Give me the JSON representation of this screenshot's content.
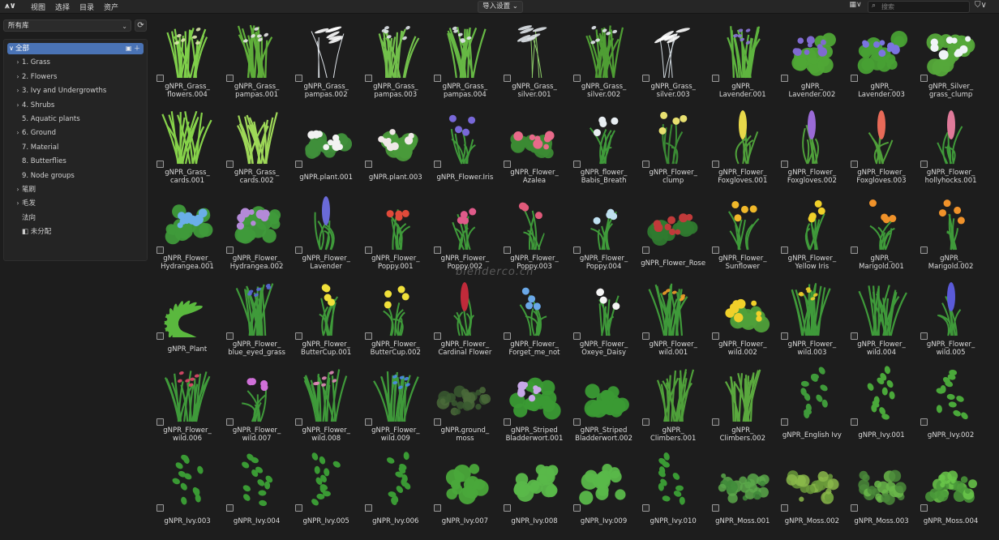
{
  "topbar": {
    "logo": "⩚∨",
    "menu": [
      "视图",
      "选择",
      "目录",
      "资产"
    ],
    "import_label": "导入设置 ⌄",
    "grid_toggle": "▦∨",
    "search_placeholder": "搜索",
    "filter": "⛉∨"
  },
  "sidebar": {
    "library": "所有库",
    "items": [
      {
        "label": "全部",
        "chev": "∨",
        "selected": true,
        "indent": 0
      },
      {
        "label": "1. Grass",
        "chev": "›",
        "indent": 1
      },
      {
        "label": "2. Flowers",
        "chev": "›",
        "indent": 1
      },
      {
        "label": "3. Ivy and Undergrowths",
        "chev": "›",
        "indent": 1
      },
      {
        "label": "4. Shrubs",
        "chev": "›",
        "indent": 1
      },
      {
        "label": "5. Aquatic plants",
        "chev": "",
        "indent": 1
      },
      {
        "label": "6. Ground",
        "chev": "›",
        "indent": 1
      },
      {
        "label": "7. Material",
        "chev": "",
        "indent": 1
      },
      {
        "label": "8. Butterflies",
        "chev": "",
        "indent": 1
      },
      {
        "label": "9. Node groups",
        "chev": "",
        "indent": 1
      },
      {
        "label": "笔刷",
        "chev": "›",
        "indent": 1
      },
      {
        "label": "毛发",
        "chev": "›",
        "indent": 1
      },
      {
        "label": "法向",
        "chev": "",
        "indent": 1
      },
      {
        "label": "未分配",
        "chev": "",
        "indent": 1,
        "icon": "file-icon"
      }
    ]
  },
  "watermark": "blenderco.cn",
  "assets": [
    {
      "label": "gNPR_Grass_\nflowers.004",
      "kind": "grass",
      "color": "#7fcf4a",
      "accent": "#dfe8b0"
    },
    {
      "label": "gNPR_Grass_\npampas.001",
      "kind": "pampas",
      "color": "#5fae3a",
      "accent": "#e8e8e8"
    },
    {
      "label": "gNPR_Grass_\npampas.002",
      "kind": "wisp",
      "color": "#dfe4ea",
      "accent": "#ffffff"
    },
    {
      "label": "gNPR_Grass_\npampas.003",
      "kind": "pampas",
      "color": "#72c04b",
      "accent": "#e0e6ea"
    },
    {
      "label": "gNPR_Grass_\npampas.004",
      "kind": "pampas",
      "color": "#66b844",
      "accent": "#e0e6ea"
    },
    {
      "label": "gNPR_Grass_\nsilver.001",
      "kind": "wisp",
      "color": "#8fd06a",
      "accent": "#e0e6ea"
    },
    {
      "label": "gNPR_Grass_\nsilver.002",
      "kind": "grass",
      "color": "#4f9e34",
      "accent": "#e5eaf0"
    },
    {
      "label": "gNPR_Grass_\nsilver.003",
      "kind": "wisp",
      "color": "#d0d8de",
      "accent": "#ffffff"
    },
    {
      "label": "gNPR_\nLavender.001",
      "kind": "grass",
      "color": "#5eb43f",
      "accent": "#8a74d6"
    },
    {
      "label": "gNPR_\nLavender.002",
      "kind": "bush",
      "color": "#4fa636",
      "accent": "#7f6ad0"
    },
    {
      "label": "gNPR_\nLavender.003",
      "kind": "bush",
      "color": "#48a034",
      "accent": "#7a74e0"
    },
    {
      "label": "gNPR_Silver_\ngrass_clump",
      "kind": "bush",
      "color": "#55a83a",
      "accent": "#f0f4f8"
    },
    {
      "label": "gNPR_Grass_\ncards.001",
      "kind": "grass",
      "color": "#86d24a",
      "accent": "#86d24a"
    },
    {
      "label": "gNPR_Grass_\ncards.002",
      "kind": "grass",
      "color": "#9ed858",
      "accent": "#9ed858"
    },
    {
      "label": "gNPR.plant.001",
      "kind": "low",
      "color": "#3f8f3a",
      "accent": "#f2f2f2"
    },
    {
      "label": "gNPR.plant.003",
      "kind": "low",
      "color": "#4a9a3a",
      "accent": "#f0e8e8"
    },
    {
      "label": "gNPR_Flower.Iris",
      "kind": "flower",
      "color": "#3f9a3a",
      "accent": "#7868d8"
    },
    {
      "label": "gNPR_Flower_\nAzalea",
      "kind": "low",
      "color": "#3b8a34",
      "accent": "#e86a8a"
    },
    {
      "label": "gNPR_flower_\nBabis_Breath",
      "kind": "flower",
      "color": "#3f9a3a",
      "accent": "#e8eef2"
    },
    {
      "label": "gNPR_Flower_\nclump",
      "kind": "flower",
      "color": "#3a8a34",
      "accent": "#e8e070"
    },
    {
      "label": "gNPR_Flower_\nFoxgloves.001",
      "kind": "spike",
      "color": "#4fa03a",
      "accent": "#e8d84a"
    },
    {
      "label": "gNPR_Flower_\nFoxgloves.002",
      "kind": "spike",
      "color": "#4fa03a",
      "accent": "#9a6ad6"
    },
    {
      "label": "gNPR_Flower_\nFoxgloves.003",
      "kind": "spike",
      "color": "#4fa03a",
      "accent": "#e86a58"
    },
    {
      "label": "gNPR_Flower_\nhollyhocks.001",
      "kind": "spike",
      "color": "#3f9a3a",
      "accent": "#e07a9a"
    },
    {
      "label": "gNPR_Flower_\nHydrangea.001",
      "kind": "bush",
      "color": "#3f9a3a",
      "accent": "#6aaee8"
    },
    {
      "label": "gNPR_Flower_\nHydrangea.002",
      "kind": "bush",
      "color": "#3f9a3a",
      "accent": "#b48ad8"
    },
    {
      "label": "gNPR_Flower_\nLavender",
      "kind": "spike",
      "color": "#3f9a3a",
      "accent": "#6a6ad8"
    },
    {
      "label": "gNPR_Flower_\nPoppy.001",
      "kind": "flower",
      "color": "#3f9a3a",
      "accent": "#e04a3a"
    },
    {
      "label": "gNPR_Flower_\nPoppy.002",
      "kind": "flower",
      "color": "#3f9a3a",
      "accent": "#e05a8a"
    },
    {
      "label": "gNPR_Flower_\nPoppy.003",
      "kind": "flower",
      "color": "#3f9a3a",
      "accent": "#e05a7a"
    },
    {
      "label": "gNPR_Flower_\nPoppy.004",
      "kind": "flower",
      "color": "#3f9a3a",
      "accent": "#bfe0f0"
    },
    {
      "label": "gNPR_Flower_Rose",
      "kind": "low",
      "color": "#2f7a2f",
      "accent": "#c03a3a"
    },
    {
      "label": "gNPR_Flower_\nSunflower",
      "kind": "flower",
      "color": "#3f9a3a",
      "accent": "#f0b82a"
    },
    {
      "label": "gNPR_Flower_\nYellow Iris",
      "kind": "flower",
      "color": "#3f9a3a",
      "accent": "#f0d02a"
    },
    {
      "label": "gNPR_\nMarigold.001",
      "kind": "flower",
      "color": "#3f9a3a",
      "accent": "#f0922a"
    },
    {
      "label": "gNPR_\nMarigold.002",
      "kind": "flower",
      "color": "#3f9a3a",
      "accent": "#f0922a"
    },
    {
      "label": "gNPR_Plant",
      "kind": "leafy",
      "color": "#5ab83e",
      "accent": "#5ab83e"
    },
    {
      "label": "gNPR_Flower_\nblue_eyed_grass",
      "kind": "grass",
      "color": "#3f9a3a",
      "accent": "#5a6ad8"
    },
    {
      "label": "gNPR_Flower_\nButterCup.001",
      "kind": "flower",
      "color": "#3f9a3a",
      "accent": "#f0e03a"
    },
    {
      "label": "gNPR_Flower_\nButterCup.002",
      "kind": "flower",
      "color": "#3f9a3a",
      "accent": "#f0e03a"
    },
    {
      "label": "gNPR_Flower_\nCardinal Flower",
      "kind": "spike",
      "color": "#3f9a3a",
      "accent": "#c02a3a"
    },
    {
      "label": "gNPR_Flower_\nForget_me_not",
      "kind": "flower",
      "color": "#3f9a3a",
      "accent": "#6aa8e8"
    },
    {
      "label": "gNPR_Flower_\nOxeye_Daisy",
      "kind": "flower",
      "color": "#3f9a3a",
      "accent": "#f4f4f4"
    },
    {
      "label": "gNPR_Flower_\nwild.001",
      "kind": "grass",
      "color": "#3f9a3a",
      "accent": "#f0a02a"
    },
    {
      "label": "gNPR_Flower_\nwild.002",
      "kind": "low",
      "color": "#4fa03a",
      "accent": "#f0d02a"
    },
    {
      "label": "gNPR_Flower_\nwild.003",
      "kind": "grass",
      "color": "#3f9a3a",
      "accent": "#f0d02a"
    },
    {
      "label": "gNPR_Flower_\nwild.004",
      "kind": "grass",
      "color": "#3f9a3a",
      "accent": "#3f9a3a"
    },
    {
      "label": "gNPR_Flower_\nwild.005",
      "kind": "spike",
      "color": "#3f9a3a",
      "accent": "#5a5ad8"
    },
    {
      "label": "gNPR_Flower_\nwild.006",
      "kind": "grass",
      "color": "#3f9a3a",
      "accent": "#e04a6a"
    },
    {
      "label": "gNPR_Flower_\nwild.007",
      "kind": "flower",
      "color": "#3f9a3a",
      "accent": "#d070d8"
    },
    {
      "label": "gNPR_Flower_\nwild.008",
      "kind": "grass",
      "color": "#3f9a3a",
      "accent": "#e08ab8"
    },
    {
      "label": "gNPR_Flower_\nwild.009",
      "kind": "grass",
      "color": "#3f9a3a",
      "accent": "#4a8ae8"
    },
    {
      "label": "gNPR.ground_\nmoss",
      "kind": "moss",
      "color": "#3a5a30",
      "accent": "#4a6a3a"
    },
    {
      "label": "gNPR_Striped\nBladderwort.001",
      "kind": "bush",
      "color": "#3a9a34",
      "accent": "#c8a8e8"
    },
    {
      "label": "gNPR_Striped\nBladderwort.002",
      "kind": "bush",
      "color": "#3a9a34",
      "accent": "#3a9a34"
    },
    {
      "label": "gNPR_\nClimbers.001",
      "kind": "grass",
      "color": "#4fa03a",
      "accent": "#4fa03a"
    },
    {
      "label": "gNPR_\nClimbers.002",
      "kind": "grass",
      "color": "#5aa83e",
      "accent": "#5aa83e"
    },
    {
      "label": "gNPR_English Ivy",
      "kind": "ivy",
      "color": "#3f9a3a",
      "accent": "#3f9a3a"
    },
    {
      "label": "gNPR_Ivy.001",
      "kind": "ivy",
      "color": "#4aa83a",
      "accent": "#4aa83a"
    },
    {
      "label": "gNPR_Ivy.002",
      "kind": "ivy",
      "color": "#4aa83a",
      "accent": "#4aa83a"
    },
    {
      "label": "gNPR_Ivy.003",
      "kind": "ivy",
      "color": "#3a9a34",
      "accent": "#3a9a34"
    },
    {
      "label": "gNPR_Ivy.004",
      "kind": "ivy",
      "color": "#3a9a34",
      "accent": "#3a9a34"
    },
    {
      "label": "gNPR_Ivy.005",
      "kind": "ivy",
      "color": "#3a9a34",
      "accent": "#3a9a34"
    },
    {
      "label": "gNPR_Ivy.006",
      "kind": "ivy",
      "color": "#3a9a34",
      "accent": "#3a9a34"
    },
    {
      "label": "gNPR_Ivy.007",
      "kind": "bush",
      "color": "#4aa83a",
      "accent": "#4aa83a"
    },
    {
      "label": "gNPR_Ivy.008",
      "kind": "bush",
      "color": "#5ab84a",
      "accent": "#5ab84a"
    },
    {
      "label": "gNPR_Ivy.009",
      "kind": "bush",
      "color": "#5ab84a",
      "accent": "#5ab84a"
    },
    {
      "label": "gNPR_Ivy.010",
      "kind": "ivy",
      "color": "#3a9a34",
      "accent": "#3a9a34"
    },
    {
      "label": "gNPR_Moss.001",
      "kind": "moss",
      "color": "#3f8a3a",
      "accent": "#5aa84a"
    },
    {
      "label": "gNPR_Moss.002",
      "kind": "moss",
      "color": "#6a9a3a",
      "accent": "#8ab84a"
    },
    {
      "label": "gNPR_Moss.003",
      "kind": "moss",
      "color": "#4a8a3a",
      "accent": "#6ab84a"
    },
    {
      "label": "gNPR_Moss.004",
      "kind": "moss",
      "color": "#4a9a3a",
      "accent": "#6ac84a"
    }
  ]
}
